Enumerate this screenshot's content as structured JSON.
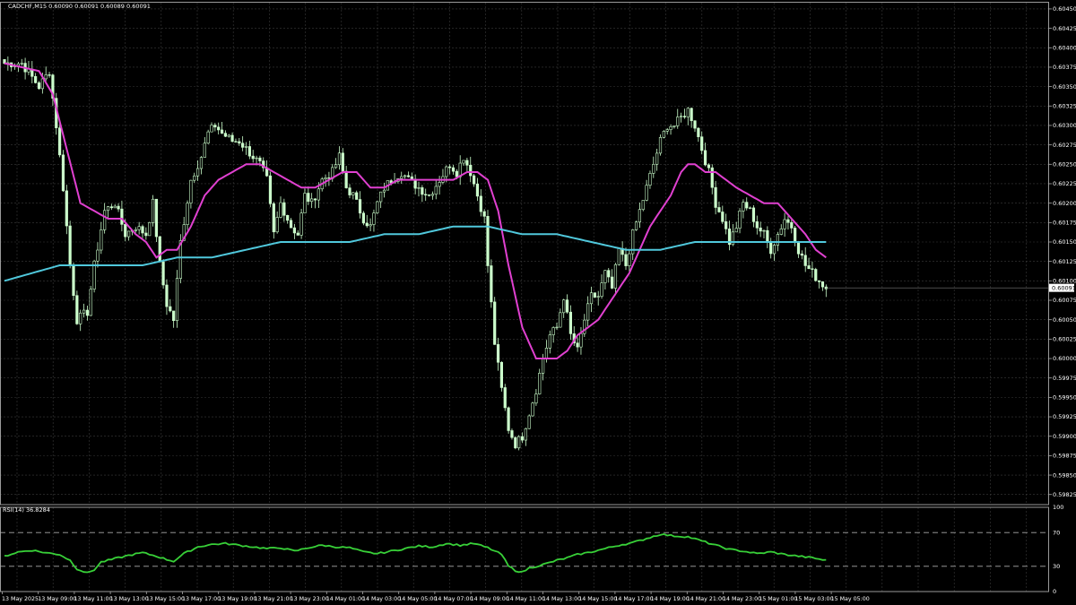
{
  "header": {
    "symbol_info": "CADCHF,M15  0.60090 0.60091 0.60089 0.60091",
    "rsi_label": "RSI(14) 36.8284"
  },
  "colors": {
    "background": "#000000",
    "grid": "#3a3a3a",
    "candle": "#ccffcc",
    "ma_fast": "#e040d0",
    "ma_slow": "#50c8dc",
    "rsi": "#38d038",
    "axis_text": "#ffffff",
    "price_tag_bg": "#ffffff",
    "price_tag_text": "#000000"
  },
  "chart_data": [
    {
      "type": "candlestick",
      "title": "CADCHF,M15",
      "timeframe": "M15",
      "ohlc_readout": {
        "open": 0.6009,
        "high": 0.60091,
        "low": 0.60089,
        "close": 0.60091
      },
      "ylim": [
        0.59812,
        0.60458
      ],
      "y_ticks": [
        "0.60450",
        "0.60425",
        "0.60400",
        "0.60375",
        "0.60350",
        "0.60325",
        "0.60300",
        "0.60275",
        "0.60250",
        "0.60225",
        "0.60200",
        "0.60175",
        "0.60150",
        "0.60125",
        "0.60100",
        "0.60075",
        "0.60050",
        "0.60025",
        "0.60000",
        "0.59975",
        "0.59950",
        "0.59925",
        "0.59900",
        "0.59875",
        "0.59850",
        "0.59825"
      ],
      "x_ticks": [
        "13 May 2025",
        "13 May 09:00",
        "13 May 11:00",
        "13 May 13:00",
        "13 May 15:00",
        "13 May 17:00",
        "13 May 19:00",
        "13 May 21:00",
        "13 May 23:00",
        "14 May 01:00",
        "14 May 03:00",
        "14 May 05:00",
        "14 May 07:00",
        "14 May 09:00",
        "14 May 11:00",
        "14 May 13:00",
        "14 May 15:00",
        "14 May 17:00",
        "14 May 19:00",
        "14 May 21:00",
        "14 May 23:00",
        "15 May 01:00",
        "15 May 03:00",
        "15 May 05:00"
      ],
      "current_price": "0.60091",
      "grid": true,
      "close_keypoints": [
        [
          0,
          0.6038
        ],
        [
          5,
          0.6038
        ],
        [
          10,
          0.6035
        ],
        [
          13,
          0.6037
        ],
        [
          15,
          0.603
        ],
        [
          17,
          0.6022
        ],
        [
          19,
          0.6012
        ],
        [
          21,
          0.6005
        ],
        [
          24,
          0.6006
        ],
        [
          26,
          0.6012
        ],
        [
          29,
          0.6019
        ],
        [
          32,
          0.602
        ],
        [
          35,
          0.6016
        ],
        [
          38,
          0.6017
        ],
        [
          41,
          0.6016
        ],
        [
          43,
          0.602
        ],
        [
          45,
          0.6012
        ],
        [
          47,
          0.6007
        ],
        [
          49,
          0.6005
        ],
        [
          51,
          0.6015
        ],
        [
          54,
          0.6023
        ],
        [
          57,
          0.6026
        ],
        [
          59,
          0.6029
        ],
        [
          61,
          0.603
        ],
        [
          63,
          0.6029
        ],
        [
          66,
          0.6028
        ],
        [
          68,
          0.6028
        ],
        [
          70,
          0.6027
        ],
        [
          72,
          0.6026
        ],
        [
          74,
          0.6025
        ],
        [
          76,
          0.6023
        ],
        [
          78,
          0.6016
        ],
        [
          80,
          0.602
        ],
        [
          83,
          0.6017
        ],
        [
          85,
          0.6016
        ],
        [
          87,
          0.6021
        ],
        [
          89,
          0.602
        ],
        [
          92,
          0.6023
        ],
        [
          95,
          0.6024
        ],
        [
          97,
          0.6026
        ],
        [
          99,
          0.6022
        ],
        [
          101,
          0.6021
        ],
        [
          104,
          0.6018
        ],
        [
          106,
          0.6017
        ],
        [
          108,
          0.602
        ],
        [
          110,
          0.6022
        ],
        [
          112,
          0.6023
        ],
        [
          115,
          0.6024
        ],
        [
          117,
          0.6023
        ],
        [
          120,
          0.6022
        ],
        [
          123,
          0.6021
        ],
        [
          126,
          0.6023
        ],
        [
          129,
          0.6025
        ],
        [
          131,
          0.6024
        ],
        [
          133,
          0.6026
        ],
        [
          135,
          0.6024
        ],
        [
          137,
          0.6021
        ],
        [
          139,
          0.6018
        ],
        [
          140,
          0.6012
        ],
        [
          142,
          0.6002
        ],
        [
          144,
          0.5996
        ],
        [
          146,
          0.5991
        ],
        [
          148,
          0.5989
        ],
        [
          150,
          0.599
        ],
        [
          152,
          0.5993
        ],
        [
          154,
          0.5996
        ],
        [
          156,
          0.6
        ],
        [
          158,
          0.6003
        ],
        [
          160,
          0.6004
        ],
        [
          162,
          0.6008
        ],
        [
          164,
          0.6003
        ],
        [
          166,
          0.6001
        ],
        [
          168,
          0.6005
        ],
        [
          170,
          0.6008
        ],
        [
          172,
          0.6008
        ],
        [
          174,
          0.6011
        ],
        [
          176,
          0.6009
        ],
        [
          178,
          0.6014
        ],
        [
          180,
          0.6012
        ],
        [
          182,
          0.6016
        ],
        [
          184,
          0.6019
        ],
        [
          186,
          0.6022
        ],
        [
          188,
          0.6025
        ],
        [
          190,
          0.6028
        ],
        [
          192,
          0.603
        ],
        [
          194,
          0.603
        ],
        [
          196,
          0.6031
        ],
        [
          198,
          0.6032
        ],
        [
          200,
          0.603
        ],
        [
          202,
          0.6027
        ],
        [
          204,
          0.6024
        ],
        [
          206,
          0.602
        ],
        [
          208,
          0.6018
        ],
        [
          210,
          0.6015
        ],
        [
          212,
          0.6017
        ],
        [
          214,
          0.602
        ],
        [
          216,
          0.6019
        ],
        [
          218,
          0.6017
        ],
        [
          220,
          0.6016
        ],
        [
          222,
          0.6014
        ],
        [
          224,
          0.6016
        ],
        [
          226,
          0.6018
        ],
        [
          228,
          0.6017
        ],
        [
          230,
          0.6014
        ],
        [
          232,
          0.6012
        ],
        [
          234,
          0.6011
        ],
        [
          236,
          0.601
        ],
        [
          238,
          0.60091
        ]
      ],
      "series": [
        {
          "name": "MA fast",
          "key": "ma_fast",
          "keypoints": [
            [
              0,
              0.6038
            ],
            [
              10,
              0.6037
            ],
            [
              14,
              0.6034
            ],
            [
              18,
              0.6027
            ],
            [
              22,
              0.602
            ],
            [
              26,
              0.6019
            ],
            [
              30,
              0.6018
            ],
            [
              34,
              0.6018
            ],
            [
              38,
              0.6016
            ],
            [
              41,
              0.6015
            ],
            [
              44,
              0.6013
            ],
            [
              47,
              0.6014
            ],
            [
              50,
              0.6014
            ],
            [
              54,
              0.6017
            ],
            [
              58,
              0.6021
            ],
            [
              62,
              0.6023
            ],
            [
              66,
              0.6024
            ],
            [
              70,
              0.6025
            ],
            [
              74,
              0.6025
            ],
            [
              78,
              0.6024
            ],
            [
              82,
              0.6023
            ],
            [
              86,
              0.6022
            ],
            [
              90,
              0.6022
            ],
            [
              94,
              0.6023
            ],
            [
              98,
              0.6024
            ],
            [
              102,
              0.6024
            ],
            [
              106,
              0.6022
            ],
            [
              110,
              0.6022
            ],
            [
              114,
              0.6023
            ],
            [
              118,
              0.6023
            ],
            [
              122,
              0.6023
            ],
            [
              126,
              0.6023
            ],
            [
              130,
              0.6023
            ],
            [
              134,
              0.6024
            ],
            [
              137,
              0.6024
            ],
            [
              140,
              0.6023
            ],
            [
              143,
              0.6019
            ],
            [
              146,
              0.6012
            ],
            [
              150,
              0.6004
            ],
            [
              154,
              0.6
            ],
            [
              156,
              0.6
            ],
            [
              158,
              0.6
            ],
            [
              160,
              0.6
            ],
            [
              163,
              0.6001
            ],
            [
              166,
              0.6003
            ],
            [
              169,
              0.6004
            ],
            [
              172,
              0.6005
            ],
            [
              175,
              0.6007
            ],
            [
              178,
              0.6009
            ],
            [
              181,
              0.6011
            ],
            [
              184,
              0.6014
            ],
            [
              187,
              0.6017
            ],
            [
              190,
              0.6019
            ],
            [
              193,
              0.6021
            ],
            [
              196,
              0.6024
            ],
            [
              198,
              0.6025
            ],
            [
              200,
              0.6025
            ],
            [
              203,
              0.6024
            ],
            [
              206,
              0.6024
            ],
            [
              209,
              0.6023
            ],
            [
              212,
              0.6022
            ],
            [
              216,
              0.6021
            ],
            [
              220,
              0.602
            ],
            [
              224,
              0.602
            ],
            [
              228,
              0.6018
            ],
            [
              232,
              0.6016
            ],
            [
              235,
              0.6014
            ],
            [
              238,
              0.6013
            ]
          ]
        },
        {
          "name": "MA slow",
          "key": "ma_slow",
          "keypoints": [
            [
              0,
              0.601
            ],
            [
              8,
              0.6011
            ],
            [
              16,
              0.6012
            ],
            [
              20,
              0.6012
            ],
            [
              30,
              0.6012
            ],
            [
              40,
              0.6012
            ],
            [
              50,
              0.6013
            ],
            [
              60,
              0.6013
            ],
            [
              70,
              0.6014
            ],
            [
              80,
              0.6015
            ],
            [
              90,
              0.6015
            ],
            [
              100,
              0.6015
            ],
            [
              110,
              0.6016
            ],
            [
              120,
              0.6016
            ],
            [
              130,
              0.6017
            ],
            [
              140,
              0.6017
            ],
            [
              150,
              0.6016
            ],
            [
              160,
              0.6016
            ],
            [
              170,
              0.6015
            ],
            [
              180,
              0.6014
            ],
            [
              190,
              0.6014
            ],
            [
              200,
              0.6015
            ],
            [
              210,
              0.6015
            ],
            [
              220,
              0.6015
            ],
            [
              230,
              0.6015
            ],
            [
              238,
              0.6015
            ]
          ]
        }
      ],
      "bar_count": 239
    },
    {
      "type": "line",
      "title": "RSI(14)",
      "last_value": 36.8284,
      "ylim": [
        0,
        100
      ],
      "y_ticks": [
        "100",
        "70",
        "30",
        "0"
      ],
      "levels": [
        70,
        30
      ],
      "series": [
        {
          "name": "RSI(14)",
          "key": "rsi",
          "keypoints": [
            [
              0,
              42
            ],
            [
              4,
              47
            ],
            [
              8,
              49
            ],
            [
              12,
              46
            ],
            [
              16,
              44
            ],
            [
              19,
              37
            ],
            [
              21,
              27
            ],
            [
              24,
              22
            ],
            [
              26,
              26
            ],
            [
              28,
              35
            ],
            [
              32,
              39
            ],
            [
              36,
              43
            ],
            [
              40,
              46
            ],
            [
              44,
              42
            ],
            [
              47,
              38
            ],
            [
              49,
              36
            ],
            [
              52,
              45
            ],
            [
              56,
              53
            ],
            [
              60,
              56
            ],
            [
              64,
              57
            ],
            [
              68,
              55
            ],
            [
              72,
              53
            ],
            [
              76,
              51
            ],
            [
              80,
              52
            ],
            [
              84,
              48
            ],
            [
              88,
              52
            ],
            [
              92,
              55
            ],
            [
              96,
              53
            ],
            [
              100,
              52
            ],
            [
              104,
              47
            ],
            [
              108,
              45
            ],
            [
              112,
              48
            ],
            [
              116,
              51
            ],
            [
              120,
              54
            ],
            [
              124,
              53
            ],
            [
              128,
              57
            ],
            [
              132,
              55
            ],
            [
              136,
              57
            ],
            [
              140,
              52
            ],
            [
              144,
              44
            ],
            [
              146,
              30
            ],
            [
              148,
              25
            ],
            [
              150,
              23
            ],
            [
              152,
              28
            ],
            [
              156,
              32
            ],
            [
              160,
              37
            ],
            [
              163,
              40
            ],
            [
              166,
              44
            ],
            [
              170,
              47
            ],
            [
              174,
              51
            ],
            [
              178,
              55
            ],
            [
              182,
              58
            ],
            [
              186,
              63
            ],
            [
              190,
              68
            ],
            [
              194,
              66
            ],
            [
              198,
              65
            ],
            [
              202,
              60
            ],
            [
              206,
              55
            ],
            [
              210,
              50
            ],
            [
              214,
              48
            ],
            [
              218,
              45
            ],
            [
              222,
              47
            ],
            [
              226,
              44
            ],
            [
              230,
              42
            ],
            [
              234,
              40
            ],
            [
              238,
              37
            ]
          ]
        }
      ]
    }
  ]
}
